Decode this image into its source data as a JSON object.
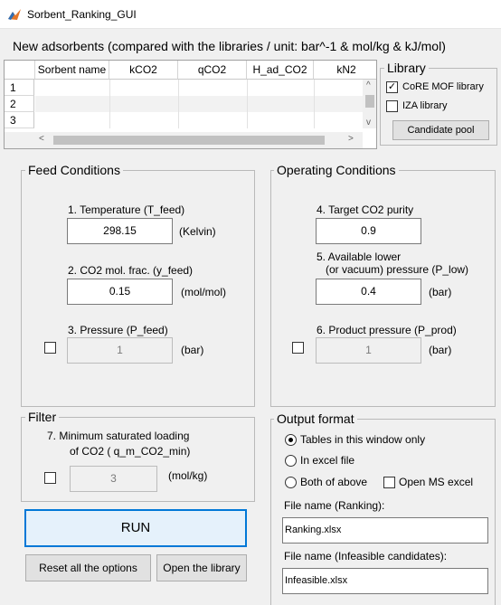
{
  "window": {
    "title": "Sorbent_Ranking_GUI"
  },
  "hint": "New adsorbents (compared with the libraries / unit: bar^-1 & mol/kg & kJ/mol)",
  "table": {
    "columns": [
      "Sorbent name",
      "kCO2",
      "qCO2",
      "H_ad_CO2",
      "kN2"
    ],
    "rows": [
      "1",
      "2",
      "3"
    ],
    "scroll_left": "<",
    "scroll_right": ">",
    "scroll_up": "^",
    "scroll_down": "v"
  },
  "library": {
    "title": "Library",
    "core_mof_label": "CoRE MOF library",
    "core_mof_checked": "✓",
    "iza_label": "IZA library",
    "candidate_button": "Candidate pool"
  },
  "feed": {
    "title": "Feed Conditions",
    "temperature_label": "1. Temperature (T_feed)",
    "temperature_value": "298.15",
    "temperature_unit": "(Kelvin)",
    "co2_label": "2. CO2 mol. frac. (y_feed)",
    "co2_value": "0.15",
    "co2_unit": "(mol/mol)",
    "pressure_label": "3. Pressure (P_feed)",
    "pressure_value": "1",
    "pressure_unit": "(bar)"
  },
  "operating": {
    "title": "Operating Conditions",
    "purity_label": "4. Target CO2 purity",
    "purity_value": "0.9",
    "lower_label_1": "5. Available lower",
    "lower_label_2": "(or vacuum) pressure (P_low)",
    "lower_value": "0.4",
    "lower_unit": "(bar)",
    "product_label": "6. Product pressure (P_prod)",
    "product_value": "1",
    "product_unit": "(bar)"
  },
  "filter": {
    "title": "Filter",
    "label_1": "7. Minimum saturated loading",
    "label_2": "of CO2 ( q_m_CO2_min)",
    "value": "3",
    "unit": "(mol/kg)"
  },
  "output": {
    "title": "Output format",
    "option_tables": "Tables in this window only",
    "option_excel": "In excel file",
    "option_both": "Both of above",
    "open_excel_label": "Open MS excel",
    "ranking_file_label": "File name (Ranking):",
    "ranking_file_value": "Ranking.xlsx",
    "infeasible_file_label": "File name (Infeasible candidates):",
    "infeasible_file_value": "Infeasible.xlsx"
  },
  "actions": {
    "run": "RUN",
    "reset": "Reset all the options",
    "open_library": "Open the library"
  }
}
